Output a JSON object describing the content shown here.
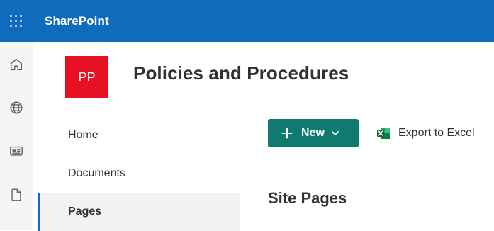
{
  "suite_bar": {
    "brand": "SharePoint",
    "color": "#0f6cbd"
  },
  "app_bar": {
    "items": [
      {
        "icon": "home-icon"
      },
      {
        "icon": "globe-icon"
      },
      {
        "icon": "news-icon"
      },
      {
        "icon": "file-icon"
      }
    ]
  },
  "site": {
    "logo_initials": "PP",
    "logo_color": "#e81123",
    "title": "Policies and Procedures"
  },
  "left_nav": {
    "items": [
      {
        "label": "Home",
        "selected": false
      },
      {
        "label": "Documents",
        "selected": false
      },
      {
        "label": "Pages",
        "selected": true
      }
    ]
  },
  "command_bar": {
    "new_label": "New",
    "new_color": "#0f7b70",
    "export_label": "Export to Excel"
  },
  "main": {
    "section_title": "Site Pages"
  }
}
